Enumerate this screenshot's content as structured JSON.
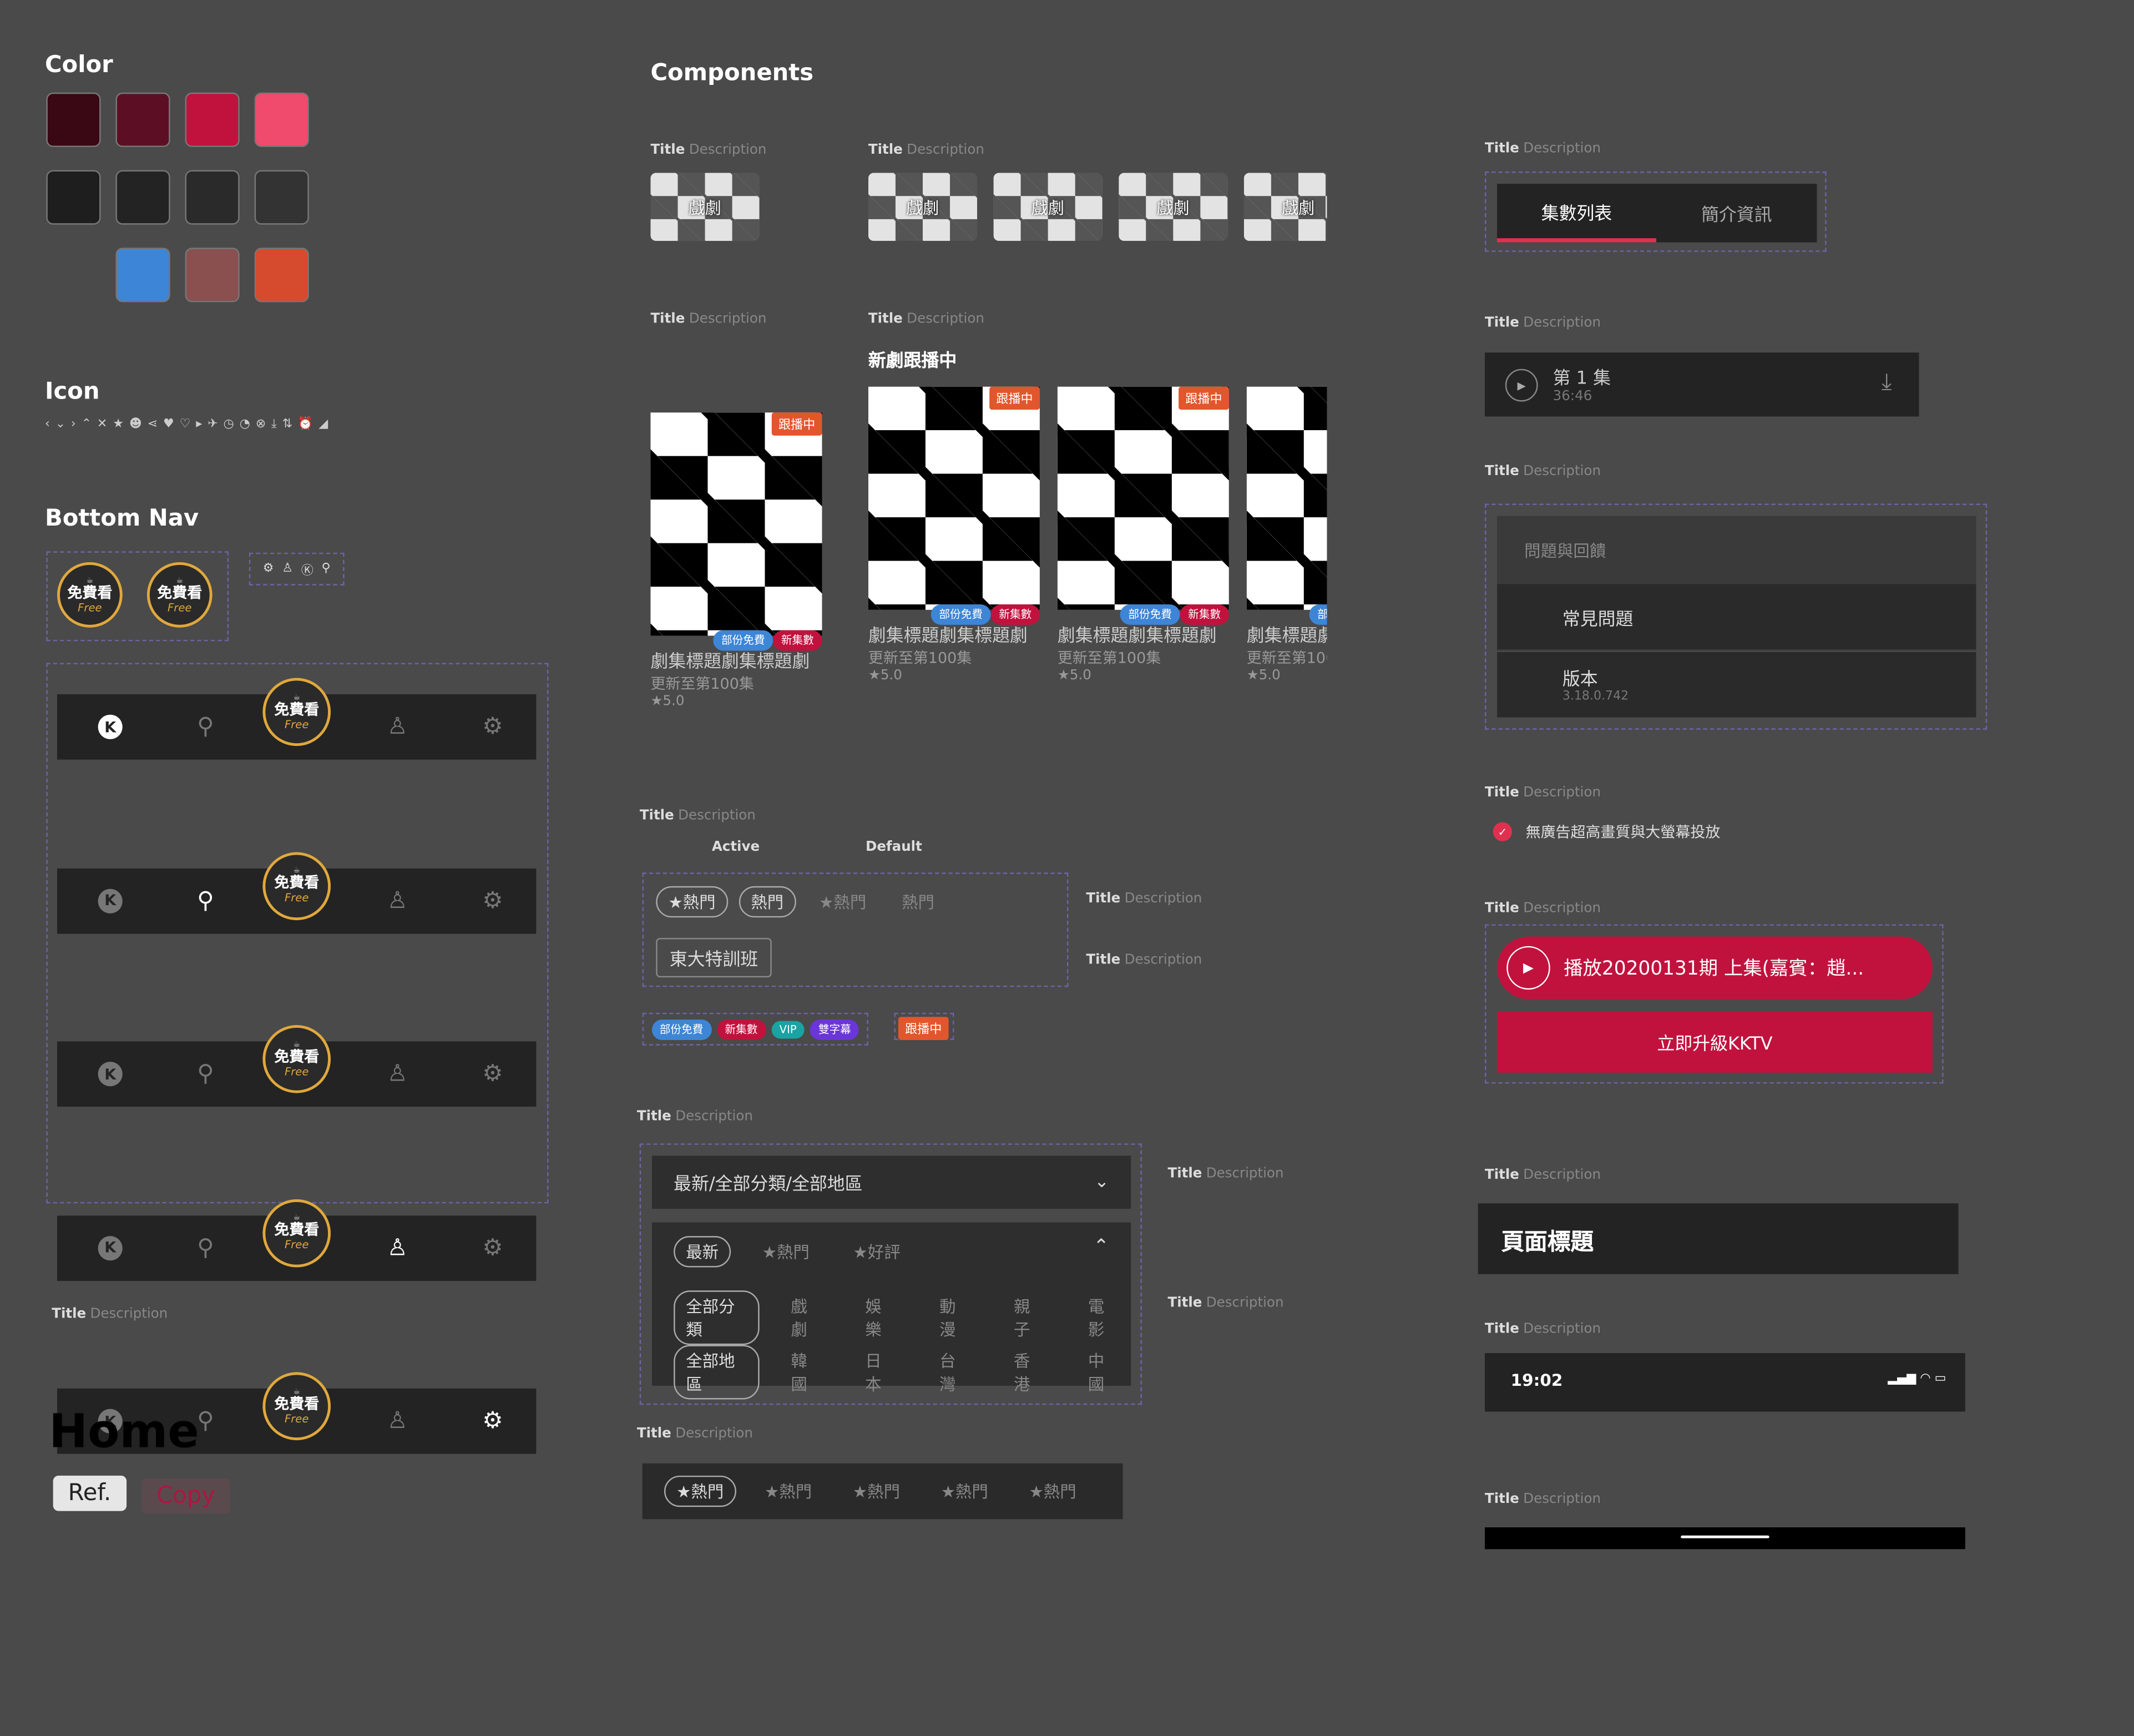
{
  "sections": {
    "color": "Color",
    "icon": "Icon",
    "bottom_nav": "Bottom Nav",
    "components": "Components"
  },
  "caption": {
    "title": "Title",
    "desc": "Description"
  },
  "colors": [
    [
      "#3a0714",
      "#5c0f24",
      "#c1123e",
      "#f04a6d"
    ],
    [
      "#232323",
      "#232323",
      "#2a2a2a",
      "#333333"
    ],
    [
      "",
      "#3d85d6",
      "#8a4f4f",
      "#d64a2d"
    ]
  ],
  "icons": [
    "‹",
    "⌄",
    "›",
    "⌃",
    "✕",
    "★",
    "☻",
    "⋖",
    "♥",
    "♡",
    "▸",
    "✈",
    "◷",
    "◔",
    "⊗",
    "⤓",
    "⇅",
    "⏰",
    "◢"
  ],
  "free_badge": {
    "top": "☕",
    "main": "免費看",
    "script": "Free"
  },
  "bottom_nav": {
    "mini_icons": [
      "⚙",
      "♙",
      "Ⓚ",
      "⚲"
    ]
  },
  "thumb_label": "戲劇",
  "tabs": {
    "episodes": "集數列表",
    "info": "簡介資訊"
  },
  "episode": {
    "title": "第 1 集",
    "duration": "36:46"
  },
  "settings": {
    "header": "問題與回饋",
    "faq": "常見問題",
    "version": "版本",
    "version_num": "3.18.0.742"
  },
  "feature": "無廣告超高畫質與大螢幕投放",
  "play_button": "播放20200131期 上集(嘉賓：趙...",
  "upgrade_button": "立即升級KKTV",
  "page_title": "頁面標題",
  "status_time": "19:02",
  "home": {
    "title": "Home",
    "ref": "Ref.",
    "copy": "Copy"
  },
  "card": {
    "badge": "跟播中",
    "title": "劇集標題劇集標題劇",
    "sub": "更新至第100集",
    "rating": "★5.0",
    "tag_partial": "部份免費",
    "tag_new": "新集數"
  },
  "new_series": "新劇跟播中",
  "chips": {
    "active": "Active",
    "default": "Default",
    "hot": "熱門",
    "star_hot": "★熱門",
    "tag": "東大特訓班"
  },
  "labels": {
    "partial": "部份免費",
    "new": "新集數",
    "vip": "VIP",
    "dual": "雙字幕",
    "following": "跟播中"
  },
  "filter": {
    "dropdown": "最新/全部分類/全部地區",
    "sort": [
      "最新",
      "★熱門",
      "★好評"
    ],
    "category": [
      "全部分類",
      "戲劇",
      "娛樂",
      "動漫",
      "親子",
      "電影"
    ],
    "region": [
      "全部地區",
      "韓國",
      "日本",
      "台灣",
      "香港",
      "中國"
    ]
  },
  "sort_bar": [
    "★熱門",
    "★熱門",
    "★熱門",
    "★熱門",
    "★熱門"
  ]
}
